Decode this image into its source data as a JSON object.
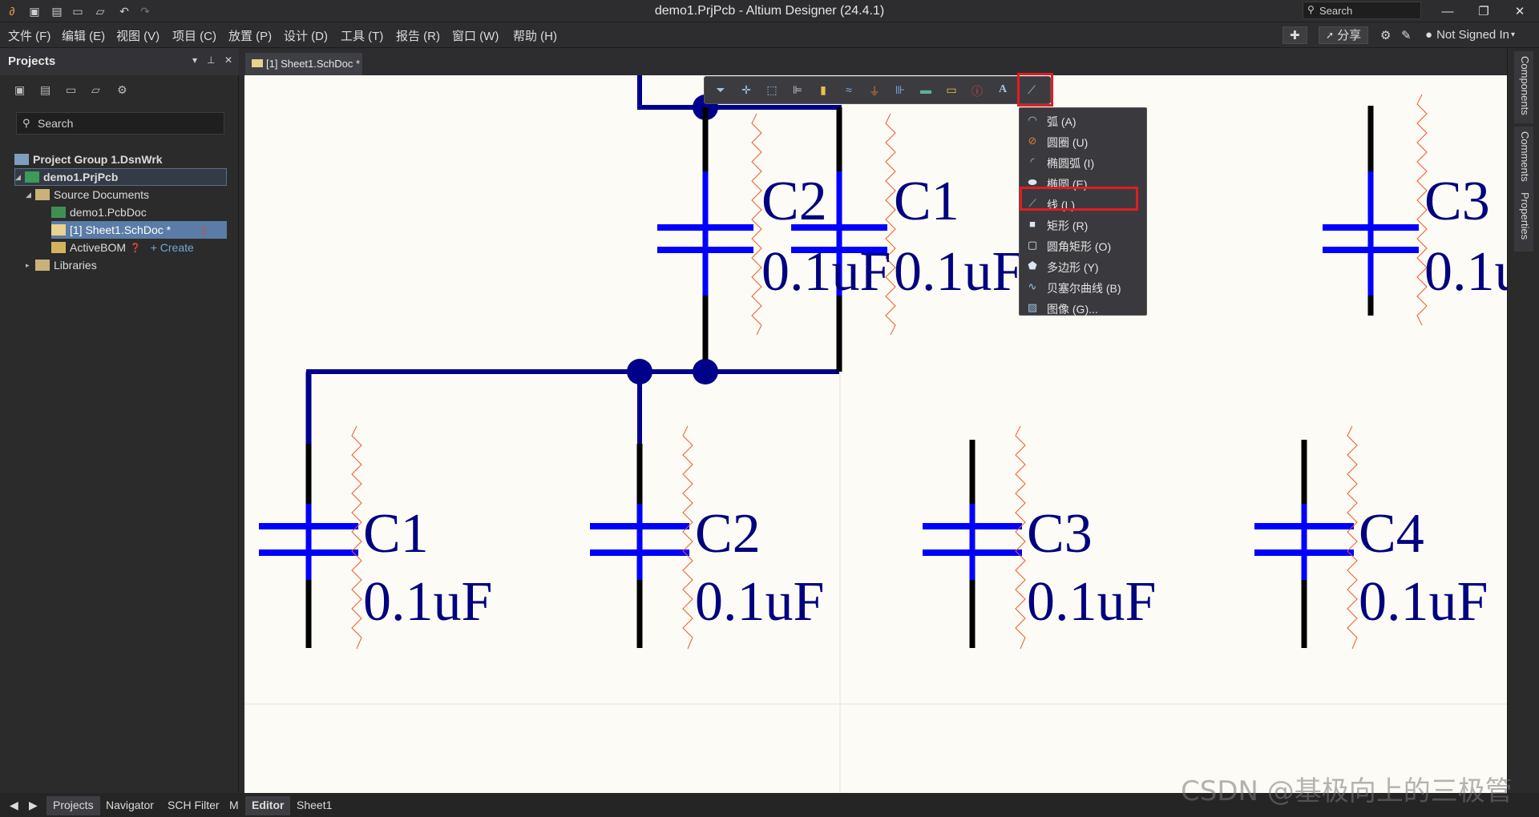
{
  "window": {
    "title": "demo1.PrjPcb - Altium Designer (24.4.1)",
    "search_placeholder": "Search"
  },
  "menu": [
    "文件 (F)",
    "编辑 (E)",
    "视图 (V)",
    "项目 (C)",
    "放置 (P)",
    "设计 (D)",
    "工具 (T)",
    "报告 (R)",
    "窗口 (W)",
    "帮助 (H)"
  ],
  "menu_right": {
    "share": "分享",
    "user": "Not Signed In"
  },
  "projects_panel": {
    "title": "Projects",
    "search_placeholder": "Search",
    "tree": [
      {
        "label": "Project Group 1.DsnWrk",
        "bold": true
      },
      {
        "label": "demo1.PrjPcb",
        "bold": true
      },
      {
        "label": "Source Documents"
      },
      {
        "label": "demo1.PcbDoc"
      },
      {
        "label": "[1] Sheet1.SchDoc *"
      },
      {
        "label": "ActiveBOM"
      },
      {
        "label": "Libraries"
      }
    ],
    "create_link": "+ Create",
    "bottom_tabs": [
      "Projects",
      "Navigator",
      "SCH Filter",
      "M"
    ]
  },
  "doc_tab": "[1] Sheet1.SchDoc *",
  "dropdown": {
    "items": [
      {
        "label": "弧 (A)",
        "icon": "arc-icon"
      },
      {
        "label": "圆圈 (U)",
        "icon": "circle-icon"
      },
      {
        "label": "椭圆弧 (I)",
        "icon": "elliptical-arc-icon"
      },
      {
        "label": "椭圆 (E)",
        "icon": "ellipse-icon"
      },
      {
        "label": "线 (L)",
        "icon": "line-icon"
      },
      {
        "label": "矩形 (R)",
        "icon": "rectangle-icon"
      },
      {
        "label": "圆角矩形 (O)",
        "icon": "round-rectangle-icon"
      },
      {
        "label": "多边形 (Y)",
        "icon": "polygon-icon"
      },
      {
        "label": "贝塞尔曲线 (B)",
        "icon": "bezier-icon"
      },
      {
        "label": "图像 (G)...",
        "icon": "image-icon"
      }
    ]
  },
  "schematic": {
    "parts": [
      {
        "designator": "C2",
        "value": "0.1uF"
      },
      {
        "designator": "C1",
        "value": "0.1uF"
      },
      {
        "designator": "C3",
        "value": "0.1u"
      },
      {
        "designator": "C1",
        "value": "0.1uF"
      },
      {
        "designator": "C2",
        "value": "0.1uF"
      },
      {
        "designator": "C3",
        "value": "0.1uF"
      },
      {
        "designator": "C4",
        "value": "0.1uF"
      }
    ]
  },
  "right_tabs": [
    "Components",
    "Comments",
    "Properties"
  ],
  "bottom_tabs": [
    "Editor",
    "Sheet1"
  ],
  "watermark": "CSDN @基极向上的三极管",
  "colors": {
    "wire": "#00008b",
    "capacitor": "#0000ff",
    "canvas": "#fdfbf5",
    "highlight": "#e11c24"
  }
}
